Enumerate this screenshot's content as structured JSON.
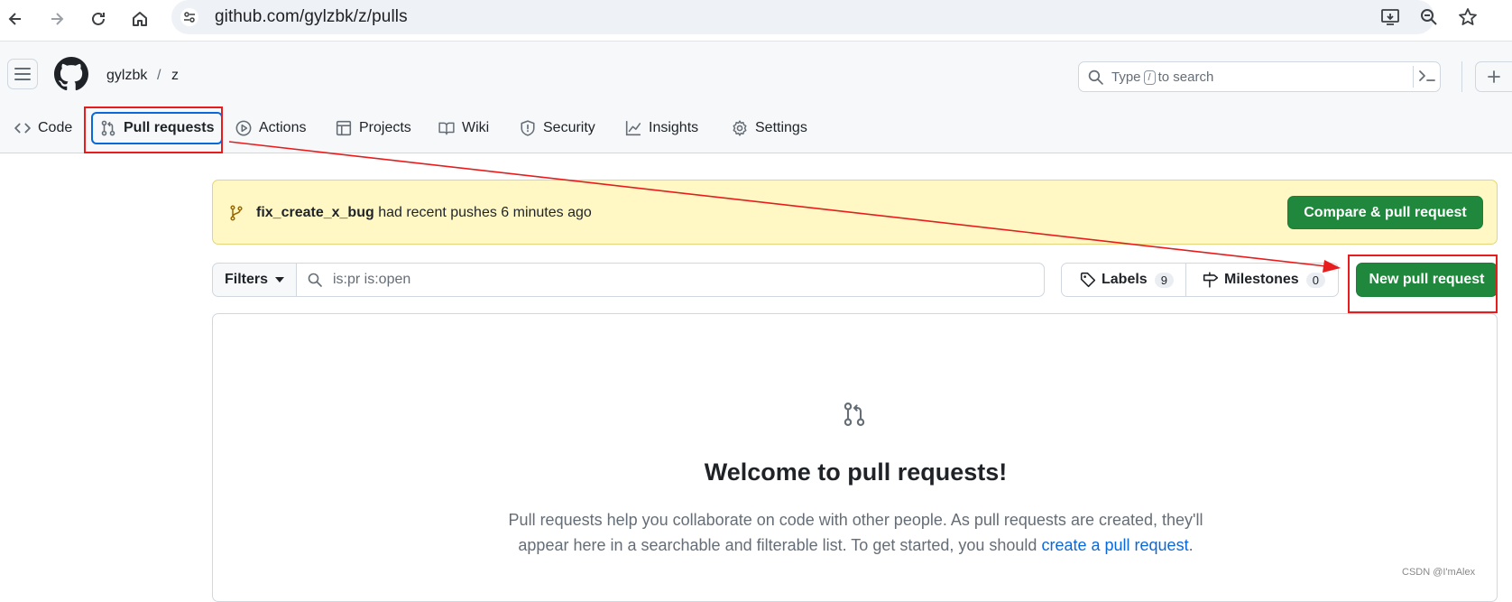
{
  "browser": {
    "url": "github.com/gylzbk/z/pulls"
  },
  "header": {
    "owner": "gylzbk",
    "separator": "/",
    "repo": "z",
    "search_prefix": "Type",
    "search_key": "/",
    "search_suffix": "to search"
  },
  "tabs": [
    {
      "label": "Code",
      "icon": "code-icon"
    },
    {
      "label": "Pull requests",
      "icon": "git-pull-request-icon"
    },
    {
      "label": "Actions",
      "icon": "play-icon"
    },
    {
      "label": "Projects",
      "icon": "table-icon"
    },
    {
      "label": "Wiki",
      "icon": "book-icon"
    },
    {
      "label": "Security",
      "icon": "shield-icon"
    },
    {
      "label": "Insights",
      "icon": "graph-icon"
    },
    {
      "label": "Settings",
      "icon": "gear-icon"
    }
  ],
  "flash": {
    "branch": "fix_create_x_bug",
    "message": "had recent pushes 6 minutes ago",
    "button": "Compare & pull request"
  },
  "filters": {
    "button": "Filters",
    "query": "is:pr is:open"
  },
  "labels": {
    "label": "Labels",
    "count": "9"
  },
  "milestones": {
    "label": "Milestones",
    "count": "0"
  },
  "new_pr_button": "New pull request",
  "blankslate": {
    "title": "Welcome to pull requests!",
    "text_line1": "Pull requests help you collaborate on code with other people. As pull requests are created, they'll",
    "text_line2": "appear here in a searchable and filterable list. To get started, you should",
    "link": "create a pull request",
    "text_end": "."
  },
  "watermark": "CSDN @I'mAlex",
  "colors": {
    "primary_green": "#1f883d",
    "annotation_red": "#e81c1c",
    "flash_bg": "#fff8c5",
    "link_blue": "#0969da"
  }
}
